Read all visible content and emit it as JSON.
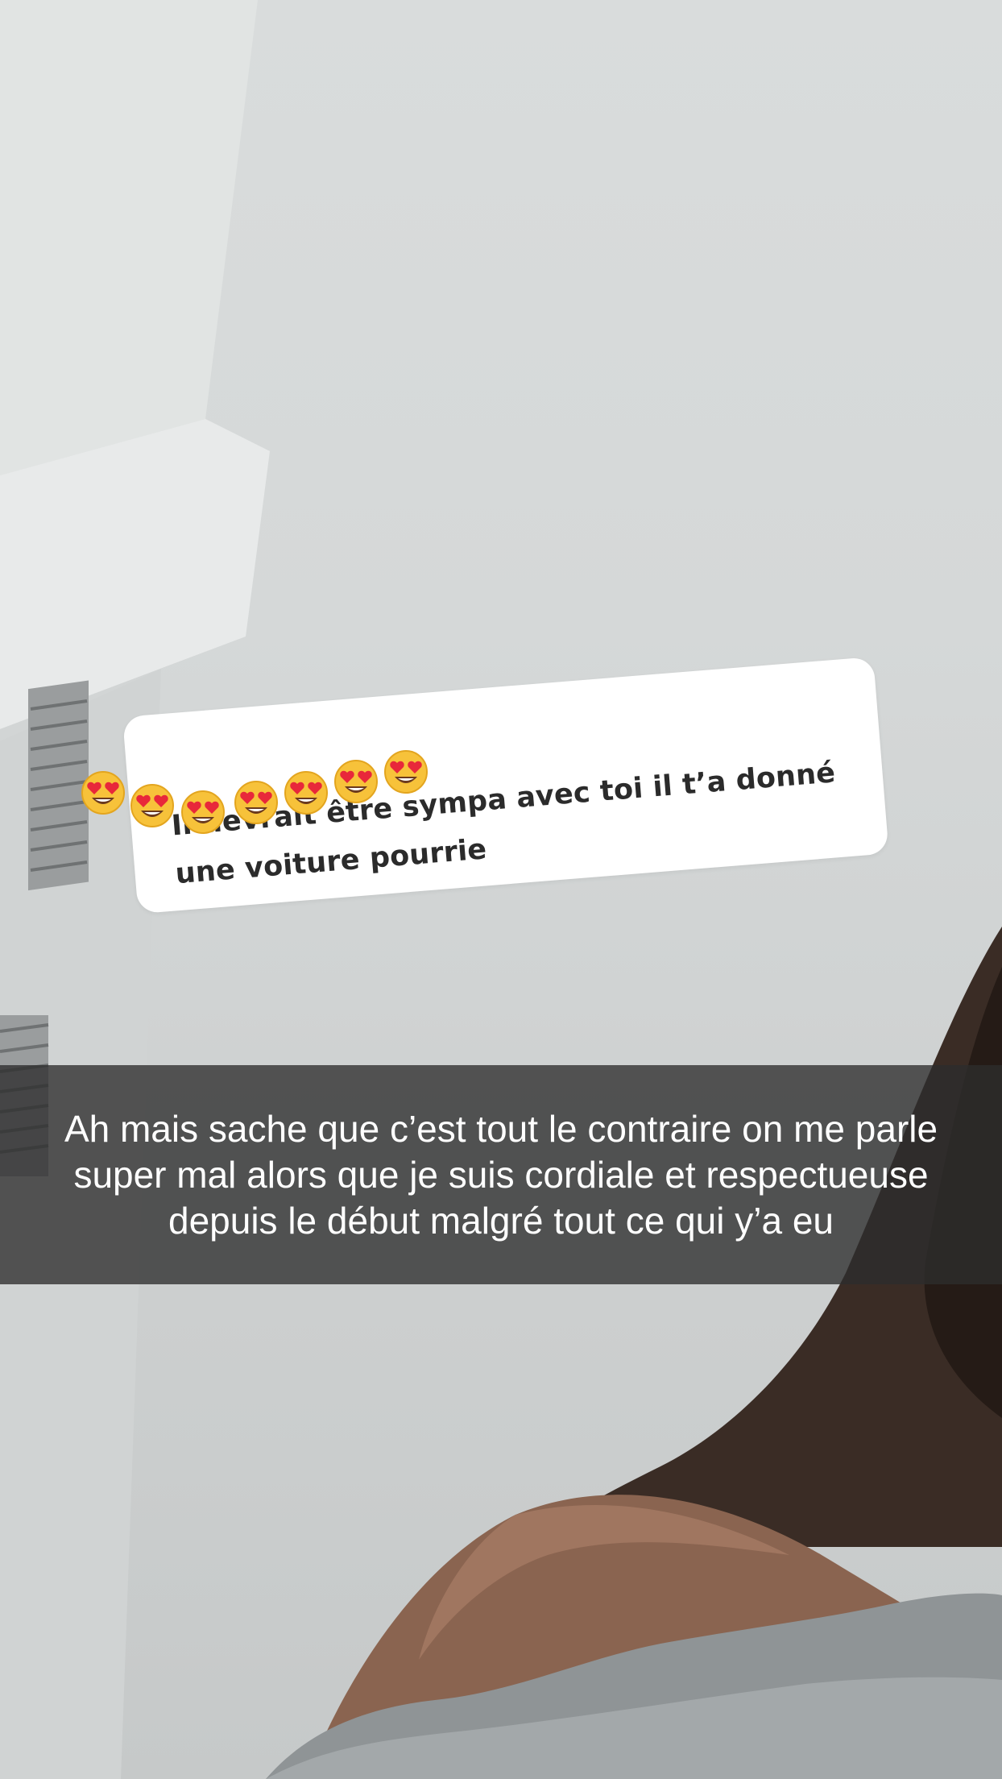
{
  "story": {
    "reply_sticker": {
      "text": "Il devrait être sympa avec toi il t’a donné une voiture pourrie"
    },
    "emoji_stickers": [
      {
        "icon": "heart-eyes-emoji"
      },
      {
        "icon": "heart-eyes-emoji"
      },
      {
        "icon": "heart-eyes-emoji"
      },
      {
        "icon": "heart-eyes-emoji"
      },
      {
        "icon": "heart-eyes-emoji"
      },
      {
        "icon": "heart-eyes-emoji"
      },
      {
        "icon": "heart-eyes-emoji"
      }
    ],
    "caption": "Ah mais sache que c’est tout le contraire on me parle super mal alors que je suis cordiale et respectueuse depuis le début malgré tout ce qui y’a eu"
  },
  "colors": {
    "caption_bar": "#2d2d2d",
    "reply_card": "#ffffff",
    "reply_text": "#2b2b2b"
  }
}
